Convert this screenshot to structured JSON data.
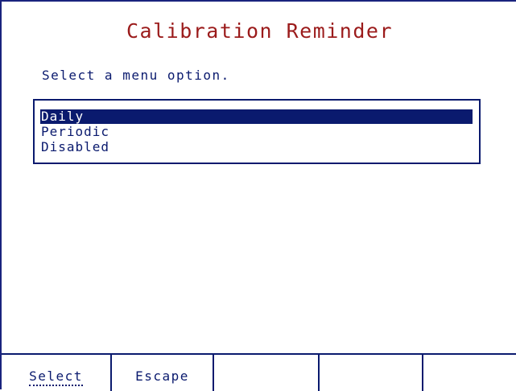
{
  "title": "Calibration Reminder",
  "instruction": "Select a menu option.",
  "menu": {
    "items": [
      {
        "label": "Daily",
        "selected": true
      },
      {
        "label": "Periodic",
        "selected": false
      },
      {
        "label": "Disabled",
        "selected": false
      }
    ]
  },
  "softkeys": [
    {
      "label": "Select"
    },
    {
      "label": "Escape"
    },
    {
      "label": ""
    },
    {
      "label": ""
    },
    {
      "label": ""
    }
  ],
  "colors": {
    "title": "#9b1b1b",
    "text": "#0a1a6e",
    "highlight_bg": "#0a1a6e",
    "highlight_text": "#ffffff"
  }
}
